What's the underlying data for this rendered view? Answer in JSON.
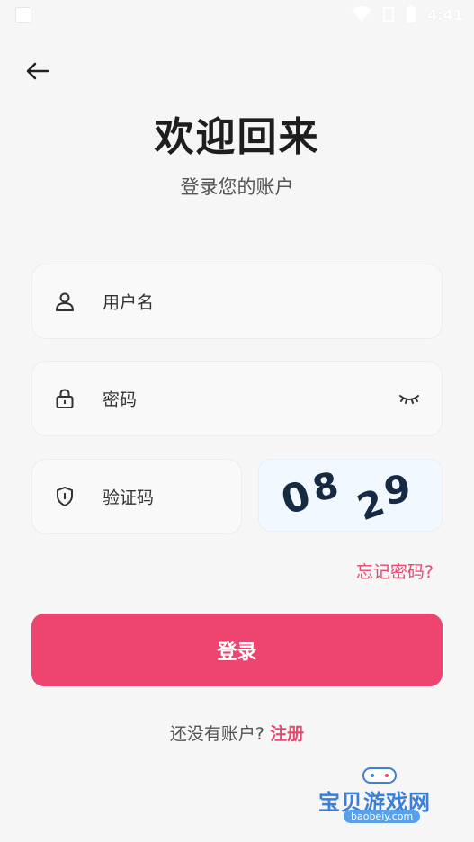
{
  "status_bar": {
    "time": "4:41"
  },
  "header": {
    "title": "欢迎回来",
    "subtitle": "登录您的账户"
  },
  "form": {
    "username_placeholder": "用户名",
    "password_placeholder": "密码",
    "captcha_placeholder": "验证码",
    "captcha_image_text": "08 29",
    "forgot_password": "忘记密码?",
    "login_button": "登录",
    "no_account_text": "还没有账户?",
    "register_link": "注册"
  },
  "watermark": {
    "name": "宝贝游戏网",
    "url": "baobeiy.com"
  },
  "colors": {
    "accent": "#ee4470",
    "link": "#e8486f",
    "background": "#f6f6f6"
  },
  "icons": [
    "back-arrow-icon",
    "user-icon",
    "lock-icon",
    "shield-icon",
    "eye-closed-icon"
  ]
}
